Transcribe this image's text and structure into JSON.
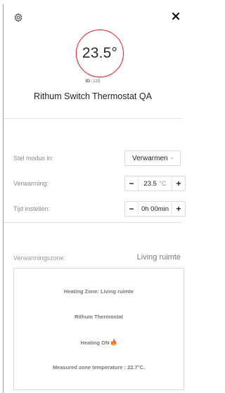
{
  "header": {
    "settings_icon": "gear-icon",
    "close_icon": "close-icon"
  },
  "thermostat": {
    "temperature": "23.5°",
    "id_label": "ID:",
    "id_value": "115",
    "name": "Rithum Switch Thermostat QA",
    "accent_color": "#d3232a"
  },
  "controls": {
    "mode_label": "Stel modus in:",
    "mode_value": "Verwarmen",
    "heating_label": "Verwarming:",
    "heating_value": "23.5",
    "heating_unit": "°C",
    "time_label": "Tijd instellen:",
    "time_value": "0h 00min",
    "minus": "−",
    "plus": "+"
  },
  "zone": {
    "label": "Verwarmingszone:",
    "value": "Living ruimte"
  },
  "info": {
    "line1": "Heating Zone: Living ruimte",
    "line2": "Rithum Thermostat",
    "line3": "Heating ON",
    "line3_icon": "flame-icon",
    "line4": "Measured zone temperature : 22.7°C."
  }
}
